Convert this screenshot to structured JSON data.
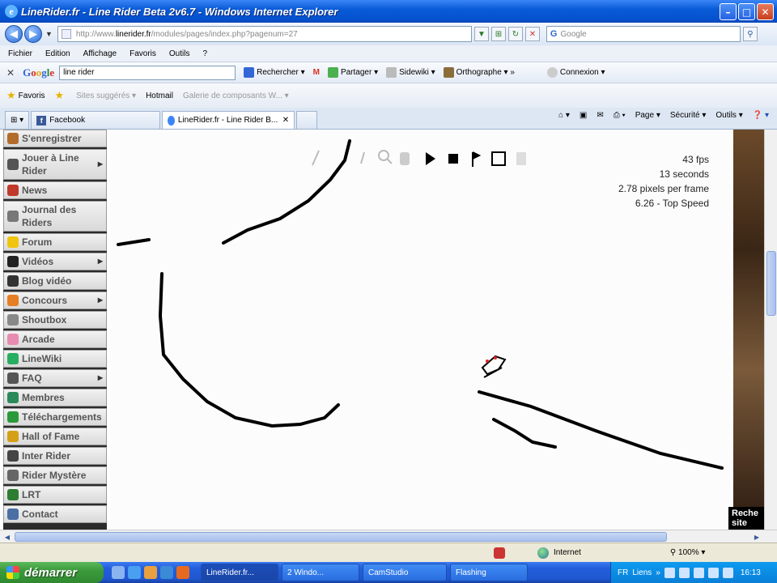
{
  "window": {
    "title": "LineRider.fr - Line Rider Beta 2v6.7 - Windows Internet Explorer"
  },
  "address": {
    "prefix": "http://www.",
    "domain": "linerider.fr",
    "path": "/modules/pages/index.php?pagenum=27"
  },
  "search": {
    "placeholder": "Google"
  },
  "menubar": [
    "Fichier",
    "Edition",
    "Affichage",
    "Favoris",
    "Outils",
    "?"
  ],
  "google_toolbar": {
    "logo": "Google",
    "query": "line rider",
    "items": [
      {
        "label": "Rechercher",
        "color": "#3367d6"
      },
      {
        "label": "Partager",
        "color": "#4caf50"
      },
      {
        "label": "Sidewiki",
        "color": "#888888"
      },
      {
        "label": "Orthographe",
        "color": "#8a6d3b"
      },
      {
        "label": "Connexion",
        "color": "#999999"
      }
    ]
  },
  "favorites": {
    "favoris": "Favoris",
    "items": [
      {
        "label": "Sites suggérés",
        "dim": true
      },
      {
        "label": "Hotmail",
        "dim": false
      },
      {
        "label": "Galerie de composants W...",
        "dim": true
      }
    ]
  },
  "tabs": [
    {
      "label": "Facebook",
      "active": false
    },
    {
      "label": "LineRider.fr - Line Rider B...",
      "active": true
    }
  ],
  "tab_tools": [
    "Page",
    "Sécurité",
    "Outils"
  ],
  "sidebar": [
    {
      "label": "S'enregistrer",
      "arrow": false,
      "color": "#b36b2c"
    },
    {
      "label": "Jouer à Line Rider",
      "arrow": true,
      "color": "#555555"
    },
    {
      "label": "News",
      "arrow": false,
      "color": "#c0392b"
    },
    {
      "label": "Journal des Riders",
      "arrow": false,
      "color": "#777777"
    },
    {
      "label": "Forum",
      "arrow": false,
      "color": "#f1c40f"
    },
    {
      "label": "Vidéos",
      "arrow": true,
      "color": "#222222"
    },
    {
      "label": "Blog vidéo",
      "arrow": false,
      "color": "#333333"
    },
    {
      "label": "Concours",
      "arrow": true,
      "color": "#e67e22"
    },
    {
      "label": "Shoutbox",
      "arrow": false,
      "color": "#888888"
    },
    {
      "label": "Arcade",
      "arrow": false,
      "color": "#e88bb0"
    },
    {
      "label": "LineWiki",
      "arrow": false,
      "color": "#27ae60"
    },
    {
      "label": "FAQ",
      "arrow": true,
      "color": "#555555"
    },
    {
      "label": "Membres",
      "arrow": false,
      "color": "#2c8a5a"
    },
    {
      "label": "Téléchargements",
      "arrow": false,
      "color": "#2a9a3a"
    },
    {
      "label": "Hall of Fame",
      "arrow": false,
      "color": "#d4a017"
    },
    {
      "label": "Inter Rider",
      "arrow": false,
      "color": "#444444"
    },
    {
      "label": "Rider Mystère",
      "arrow": false,
      "color": "#666666"
    },
    {
      "label": "LRT",
      "arrow": false,
      "color": "#2e7d32"
    },
    {
      "label": "Contact",
      "arrow": false,
      "color": "#4a6fa5"
    }
  ],
  "game": {
    "stats": [
      "43 fps",
      "13 seconds",
      "2.78 pixels per frame",
      "6.26 - Top Speed"
    ],
    "toolbar": [
      "pencil-icon",
      "line-icon",
      "eraser-icon",
      "zoom-icon",
      "hand-icon",
      "play-icon",
      "stop-icon",
      "flag-icon",
      "save-icon",
      "trash-icon"
    ]
  },
  "right_panel_label": "Reche site",
  "statusbar": {
    "zone": "Internet",
    "zoom": "100%"
  },
  "taskbar": {
    "start": "démarrer",
    "buttons": [
      {
        "label": "LineRider.fr...",
        "active": true
      },
      {
        "label": "2 Windo...",
        "active": false
      },
      {
        "label": "CamStudio",
        "active": false
      },
      {
        "label": "Flashing",
        "active": false
      }
    ],
    "tray": {
      "lang": "FR",
      "links": "Liens",
      "time": "16:13"
    }
  },
  "colors": {
    "titlebar": "#0a5bd8",
    "taskbar": "#245edb",
    "start": "#3c9a3c"
  }
}
